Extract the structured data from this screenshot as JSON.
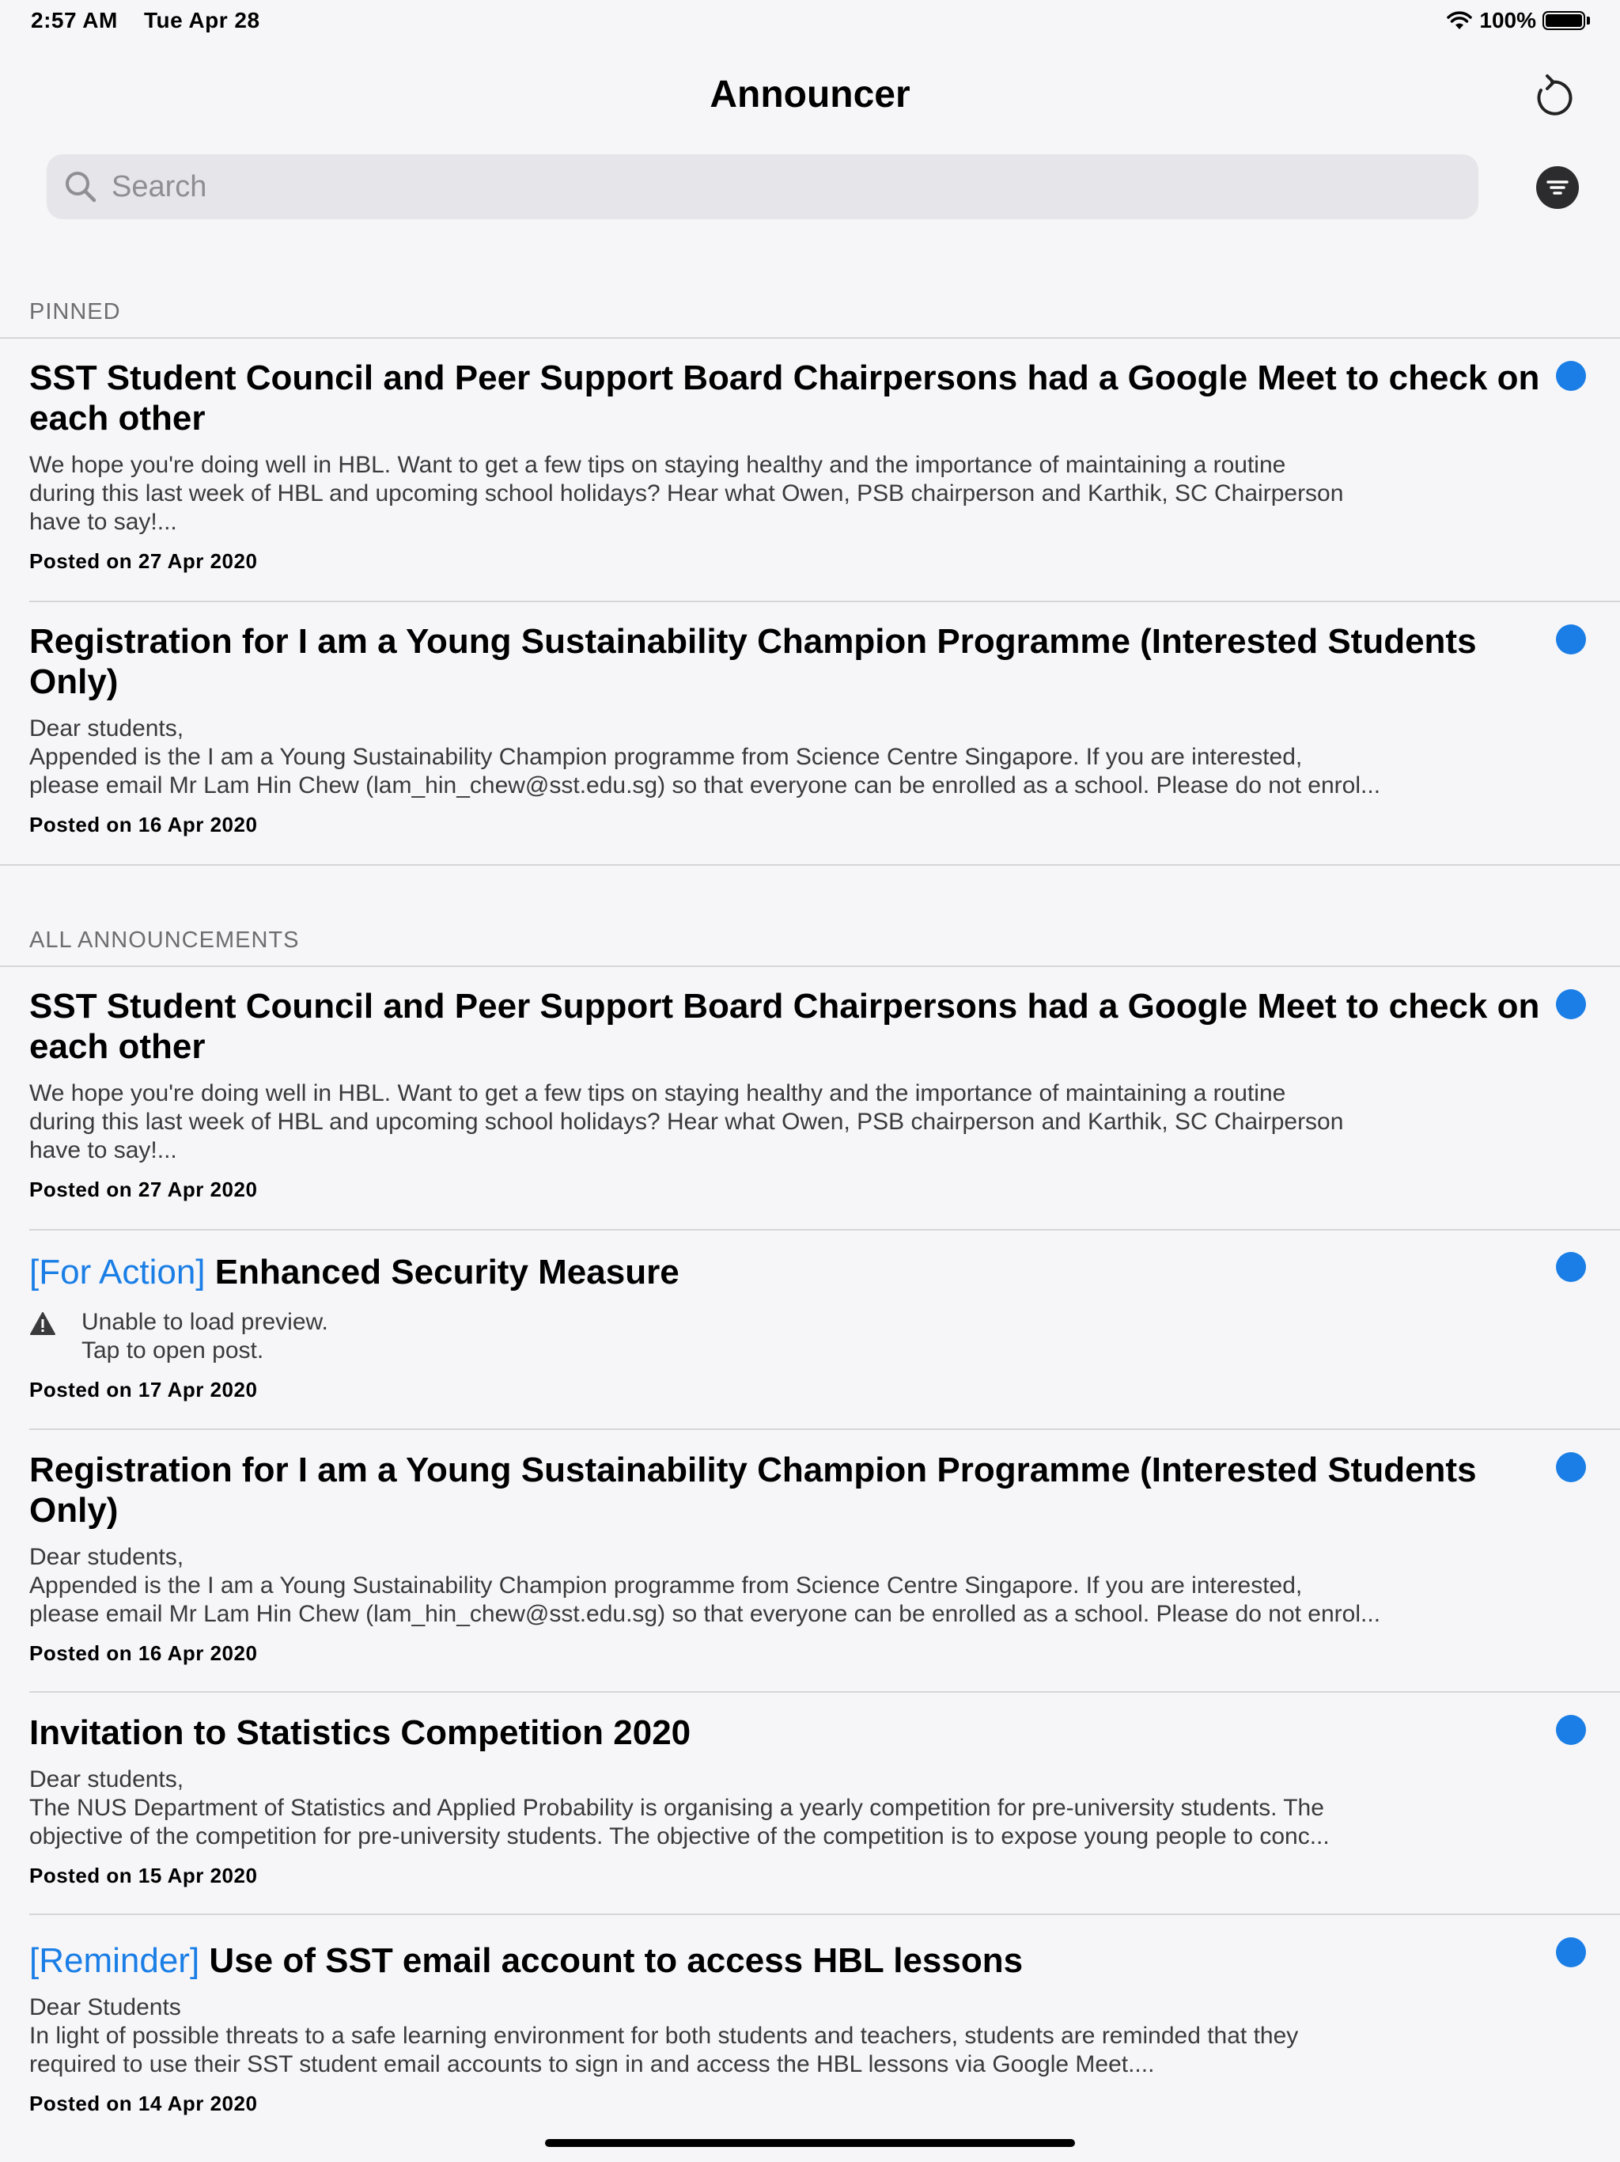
{
  "status_bar": {
    "time": "2:57 AM",
    "date": "Tue Apr 28",
    "battery": "100%"
  },
  "nav": {
    "title": "Announcer"
  },
  "search": {
    "placeholder": "Search"
  },
  "sections": {
    "pinned": "PINNED",
    "all": "ALL ANNOUNCEMENTS"
  },
  "pinned_posts": [
    {
      "title": "SST Student Council and Peer Support Board Chairpersons had a Google Meet to check on each other",
      "excerpt_lines": [
        "We hope you're doing well in HBL. Want to get a few tips on staying healthy and the importance of maintaining a routine",
        "during this last week of HBL and upcoming school holidays? Hear what Owen, PSB chairperson and Karthik, SC Chairperson",
        "have to say!..."
      ],
      "date": "Posted on 27 Apr 2020"
    },
    {
      "title": "Registration for I am a Young Sustainability Champion Programme (Interested Students Only)",
      "excerpt_lines": [
        "Dear students,",
        "Appended is the I am a Young Sustainability Champion programme from Science Centre Singapore. If you are interested,",
        "please email Mr Lam Hin Chew (lam_hin_chew@sst.edu.sg) so that everyone can be enrolled as a school. Please do not enrol..."
      ],
      "date": "Posted on 16 Apr 2020"
    }
  ],
  "all_posts": [
    {
      "title": "SST Student Council and Peer Support Board Chairpersons had a Google Meet to check on each other",
      "excerpt_lines": [
        "We hope you're doing well in HBL. Want to get a few tips on staying healthy and the importance of maintaining a routine",
        "during this last week of HBL and upcoming school holidays? Hear what Owen, PSB chairperson and Karthik, SC Chairperson",
        "have to say!..."
      ],
      "date": "Posted on 27 Apr 2020"
    },
    {
      "tag": "[For Action]",
      "title": "Enhanced Security Measure",
      "preview_error_lines": [
        "Unable to load preview.",
        "Tap to open post."
      ],
      "date": "Posted on 17 Apr 2020"
    },
    {
      "title": "Registration for I am a Young Sustainability Champion Programme (Interested Students Only)",
      "excerpt_lines": [
        "Dear students,",
        "Appended is the I am a Young Sustainability Champion programme from Science Centre Singapore. If you are interested,",
        "please email Mr Lam Hin Chew (lam_hin_chew@sst.edu.sg) so that everyone can be enrolled as a school. Please do not enrol..."
      ],
      "date": "Posted on 16 Apr 2020"
    },
    {
      "title": "Invitation to Statistics Competition 2020",
      "excerpt_lines": [
        "Dear students,",
        "The NUS Department of Statistics and Applied Probability is organising a yearly competition for pre-university students. The",
        "objective of the competition for pre-university students. The objective of the competition is to expose young people to conc..."
      ],
      "date": "Posted on 15 Apr 2020"
    },
    {
      "tag": "[Reminder]",
      "title": "Use of SST email account to access HBL lessons",
      "excerpt_lines": [
        "Dear Students",
        "In light of possible threats to a safe learning environment for both students and teachers, students are reminded that they",
        "required to use their SST student email accounts to sign in and access the HBL lessons via Google Meet...."
      ],
      "date": "Posted on 14 Apr 2020"
    }
  ],
  "colors": {
    "accent": "#1a7ee6",
    "background": "#f6f6f8",
    "search_field": "#e6e6ea"
  },
  "icons": {
    "refresh": "refresh-icon",
    "search": "search-icon",
    "filter": "filter-icon",
    "wifi": "wifi-icon",
    "battery": "battery-icon",
    "warning": "warning-icon"
  }
}
